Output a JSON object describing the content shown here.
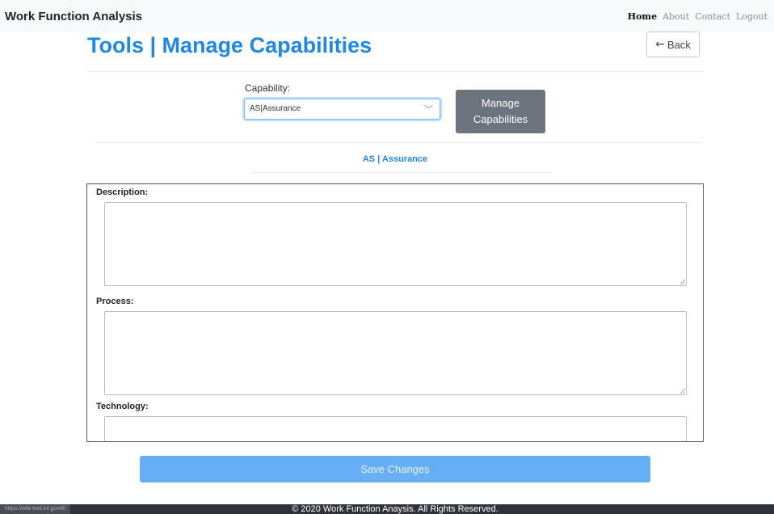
{
  "navbar": {
    "brand": "Work Function Analysis",
    "links": [
      "Home",
      "About",
      "Contact",
      "Logout"
    ]
  },
  "header": {
    "title": "Tools | Manage Capabilities",
    "back_label": "Back"
  },
  "capability": {
    "label": "Capability:",
    "selected": "AS|Assurance",
    "manage_label": "Manage Capabilities"
  },
  "section": {
    "heading": "AS | Assurance"
  },
  "fields": {
    "description_label": "Description:",
    "description_value": "",
    "process_label": "Process:",
    "process_value": "",
    "technology_label": "Technology:",
    "technology_value": ""
  },
  "actions": {
    "save_label": "Save Changes"
  },
  "footer": {
    "copyright": "© 2020 Work Function Anaysis. All Rights Reserved.",
    "status_url": "https://wfa-tool.inl.gov/#/"
  },
  "colors": {
    "accent": "#1f87e4",
    "manage_button": "#6c757d",
    "save_button": "#66aef5",
    "footer": "#2f3236"
  }
}
